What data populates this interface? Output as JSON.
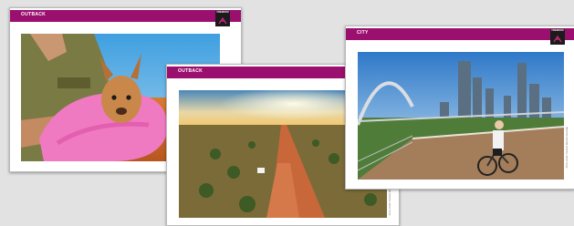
{
  "colors": {
    "accent": "#9b0f6f",
    "background": "#e2e2e2",
    "card": "#ffffff"
  },
  "cards": [
    {
      "label": "OUTBACK",
      "logo": "FREEDOM",
      "logo_icon": "brand-logo-icon",
      "photo": "kangaroo-joey-in-pink-towel"
    },
    {
      "label": "OUTBACK",
      "logo": "FREEDOM",
      "logo_icon": "brand-logo-icon",
      "photo": "red-dirt-road-sunset",
      "credit": "Photo credit: Tourism Western Australia"
    },
    {
      "label": "CITY",
      "logo": "FREEDOM",
      "logo_icon": "brand-logo-icon",
      "photo": "cyclist-on-bridge-city-skyline",
      "credit": "Photo credit: Tourism Western Australia"
    }
  ]
}
